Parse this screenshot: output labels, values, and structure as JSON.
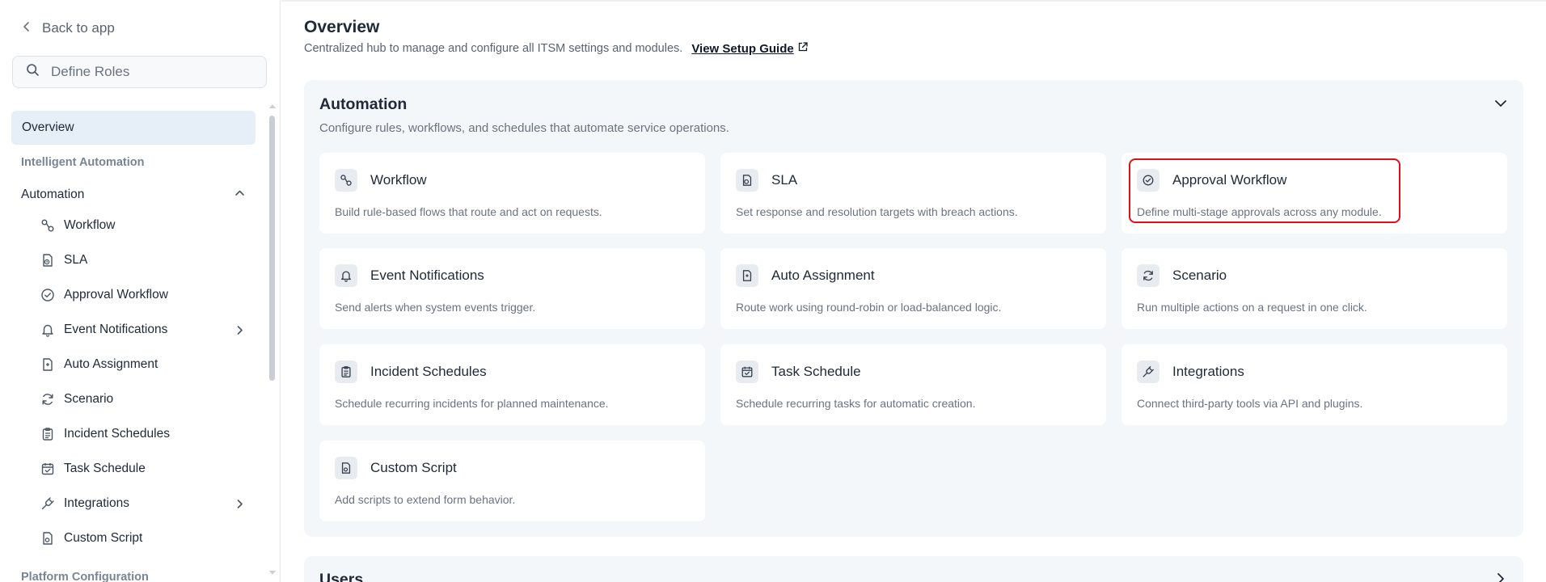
{
  "sidebar": {
    "back_label": "Back to app",
    "search_placeholder": "Define Roles",
    "overview_label": "Overview",
    "section_intelligent": "Intelligent Automation",
    "group_automation": "Automation",
    "items": [
      {
        "label": "Workflow",
        "icon": "workflow-icon"
      },
      {
        "label": "SLA",
        "icon": "sla-icon"
      },
      {
        "label": "Approval Workflow",
        "icon": "check-circle-icon"
      },
      {
        "label": "Event Notifications",
        "icon": "bell-icon"
      },
      {
        "label": "Auto Assignment",
        "icon": "auto-assign-icon"
      },
      {
        "label": "Scenario",
        "icon": "refresh-icon"
      },
      {
        "label": "Incident Schedules",
        "icon": "clipboard-icon"
      },
      {
        "label": "Task Schedule",
        "icon": "calendar-check-icon"
      },
      {
        "label": "Integrations",
        "icon": "plug-icon"
      },
      {
        "label": "Custom Script",
        "icon": "script-icon"
      }
    ],
    "section_platform": "Platform Configuration"
  },
  "main": {
    "title": "Overview",
    "subtitle": "Centralized hub to manage and configure all ITSM settings and modules.",
    "guide_link": "View Setup Guide",
    "automation": {
      "title": "Automation",
      "subtitle": "Configure rules, workflows, and schedules that automate service operations.",
      "cards": [
        {
          "title": "Workflow",
          "desc": "Build rule-based flows that route and act on requests.",
          "icon": "workflow-icon"
        },
        {
          "title": "SLA",
          "desc": "Set response and resolution targets with breach actions.",
          "icon": "sla-icon"
        },
        {
          "title": "Approval Workflow",
          "desc": "Define multi-stage approvals across any module.",
          "icon": "check-circle-icon"
        },
        {
          "title": "Event Notifications",
          "desc": "Send alerts when system events trigger.",
          "icon": "bell-icon"
        },
        {
          "title": "Auto Assignment",
          "desc": "Route work using round-robin or load-balanced logic.",
          "icon": "auto-assign-icon"
        },
        {
          "title": "Scenario",
          "desc": "Run multiple actions on a request in one click.",
          "icon": "refresh-icon"
        },
        {
          "title": "Incident Schedules",
          "desc": "Schedule recurring incidents for planned maintenance.",
          "icon": "clipboard-icon"
        },
        {
          "title": "Task Schedule",
          "desc": "Schedule recurring tasks for automatic creation.",
          "icon": "calendar-check-icon"
        },
        {
          "title": "Integrations",
          "desc": "Connect third-party tools via API and plugins.",
          "icon": "plug-icon"
        },
        {
          "title": "Custom Script",
          "desc": "Add scripts to extend form behavior.",
          "icon": "script-icon"
        }
      ]
    },
    "users": {
      "title": "Users"
    }
  },
  "colors": {
    "highlight": "#e0101b",
    "active_nav_bg": "#e6eef8",
    "panel_bg": "#f4f7fa"
  }
}
